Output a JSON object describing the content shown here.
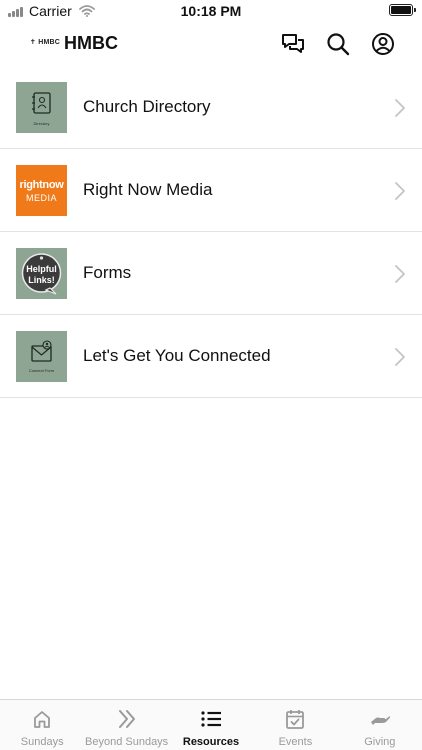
{
  "status_bar": {
    "carrier": "Carrier",
    "time": "10:18 PM"
  },
  "header": {
    "logo_text": "HMBC",
    "title": "HMBC"
  },
  "items": [
    {
      "label": "Church Directory",
      "thumb_text": "Directory",
      "thumb_color": "#8fa593"
    },
    {
      "label": "Right Now Media",
      "thumb_line1": "rightnow",
      "thumb_line2": "MEDIA",
      "thumb_color": "#f07a1a"
    },
    {
      "label": "Forms",
      "thumb_line1": "Helpful",
      "thumb_line2": "Links!",
      "thumb_color": "#8fa593"
    },
    {
      "label": "Let's Get You Connected",
      "thumb_text": "Connect Form",
      "thumb_color": "#8fa593"
    }
  ],
  "tabs": [
    {
      "label": "Sundays",
      "icon": "home-icon"
    },
    {
      "label": "Beyond Sundays",
      "icon": "double-chevron-icon"
    },
    {
      "label": "Resources",
      "icon": "list-icon",
      "active": true
    },
    {
      "label": "Events",
      "icon": "calendar-check-icon"
    },
    {
      "label": "Giving",
      "icon": "hand-icon"
    }
  ]
}
